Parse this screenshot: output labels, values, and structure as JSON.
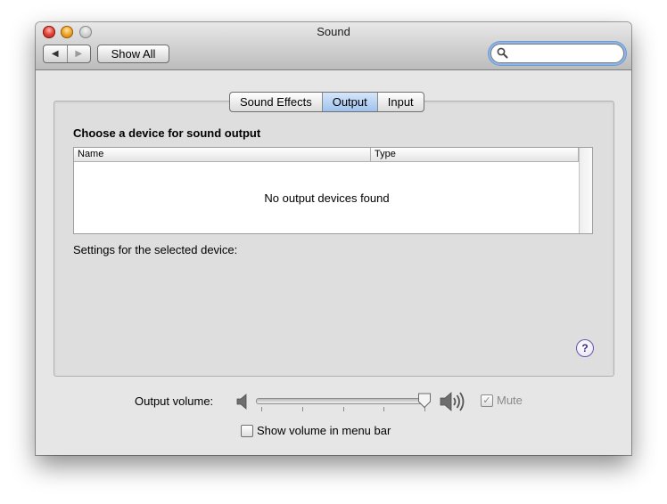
{
  "window": {
    "title": "Sound",
    "show_all_label": "Show All",
    "search": {
      "placeholder": "",
      "value": ""
    }
  },
  "tabs": [
    {
      "label": "Sound Effects",
      "active": false
    },
    {
      "label": "Output",
      "active": true
    },
    {
      "label": "Input",
      "active": false
    }
  ],
  "output": {
    "heading": "Choose a device for sound output",
    "columns": [
      "Name",
      "Type"
    ],
    "empty_message": "No output devices found",
    "settings_label": "Settings for the selected device:"
  },
  "volume": {
    "label": "Output volume:",
    "level": 1.0,
    "mute_label": "Mute",
    "mute_checked": true,
    "show_in_menubar_label": "Show volume in menu bar",
    "show_in_menubar_checked": false
  },
  "icons": {
    "back": "chevron-left-icon",
    "forward": "chevron-right-icon",
    "search": "search-icon",
    "help": "help-icon",
    "volume_low": "speaker-low-icon",
    "volume_high": "speaker-high-icon"
  },
  "colors": {
    "active_tab": "#9ec2ee",
    "search_focus": "#6b9bd8",
    "help_border": "#6a56a8"
  }
}
